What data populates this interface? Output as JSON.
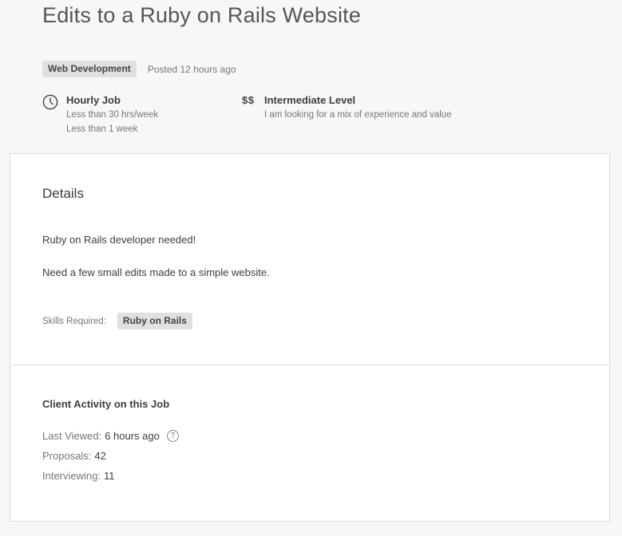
{
  "job": {
    "title": "Edits to a Ruby on Rails Website",
    "category": "Web Development",
    "posted": "Posted 12 hours ago"
  },
  "hourly": {
    "icon": "clock-icon",
    "title": "Hourly Job",
    "hours": "Less than 30 hrs/week",
    "duration": "Less than 1 week"
  },
  "level": {
    "icon_text": "$$",
    "title": "Intermediate Level",
    "description": "I am looking for a mix of experience and value"
  },
  "details": {
    "heading": "Details",
    "line1": "Ruby on Rails developer needed!",
    "line2": "Need a few small edits made to a simple website.",
    "skills_label": "Skills Required:",
    "skills": [
      "Ruby on Rails"
    ]
  },
  "activity": {
    "heading": "Client Activity on this Job",
    "last_viewed_label": "Last Viewed:",
    "last_viewed_value": "6 hours ago",
    "help_icon": "?",
    "proposals_label": "Proposals:",
    "proposals_value": "42",
    "interviewing_label": "Interviewing:",
    "interviewing_value": "11"
  }
}
